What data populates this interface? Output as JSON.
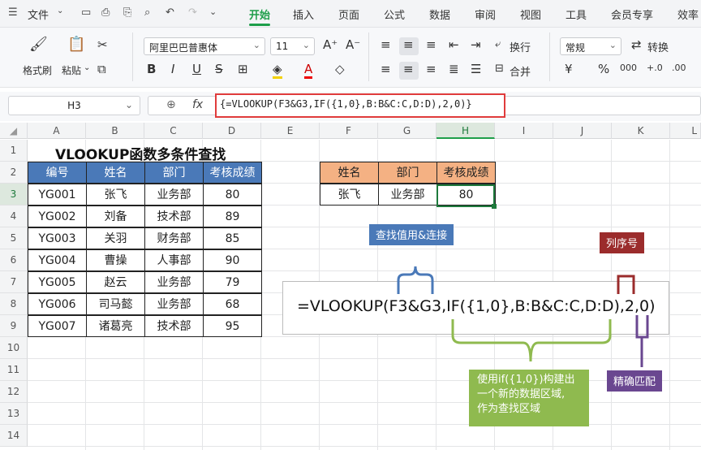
{
  "menubar": {
    "file": "文件",
    "tabs": [
      "开始",
      "插入",
      "页面",
      "公式",
      "数据",
      "审阅",
      "视图",
      "工具",
      "会员专享",
      "效率"
    ],
    "active_tab": "开始"
  },
  "ribbon": {
    "format_painter": "格式刷",
    "paste": "粘贴",
    "font_name": "阿里巴巴普惠体",
    "font_size": "11",
    "wrap": "换行",
    "merge": "合并",
    "number_format": "常规",
    "convert": "转换",
    "bold": "B",
    "italic": "I",
    "underline": "U",
    "strike": "S",
    "grow_font": "A⁺",
    "shrink_font": "A⁻",
    "currency": "¥",
    "percent": "%",
    "thousand": "000",
    "dec_inc": "+.0",
    "dec_dec": ".00"
  },
  "formula_bar": {
    "name_box": "H3",
    "fx": "fx",
    "formula": "{=VLOOKUP(F3&G3,IF({1,0},B:B&C:C,D:D),2,0)}"
  },
  "columns": [
    "A",
    "B",
    "C",
    "D",
    "E",
    "F",
    "G",
    "H",
    "I",
    "J",
    "K",
    "L"
  ],
  "rows": [
    "1",
    "2",
    "3",
    "4",
    "5",
    "6",
    "7",
    "8",
    "9",
    "10",
    "11",
    "12",
    "13",
    "14"
  ],
  "sheet": {
    "title": "VLOOKUP函数多条件查找",
    "table1": {
      "headers": [
        "编号",
        "姓名",
        "部门",
        "考核成绩"
      ],
      "rows": [
        [
          "YG001",
          "张飞",
          "业务部",
          "80"
        ],
        [
          "YG002",
          "刘备",
          "技术部",
          "89"
        ],
        [
          "YG003",
          "关羽",
          "财务部",
          "85"
        ],
        [
          "YG004",
          "曹操",
          "人事部",
          "90"
        ],
        [
          "YG005",
          "赵云",
          "业务部",
          "79"
        ],
        [
          "YG006",
          "司马懿",
          "业务部",
          "68"
        ],
        [
          "YG007",
          "诸葛亮",
          "技术部",
          "95"
        ]
      ]
    },
    "table2": {
      "headers": [
        "姓名",
        "部门",
        "考核成绩"
      ],
      "row": [
        "张飞",
        "业务部",
        "80"
      ]
    }
  },
  "annotations": {
    "formula": "=VLOOKUP(F3&G3,IF({1,0},B:B&C:C,D:D),2,0)",
    "lookup_value": "查找值用&连接",
    "col_index": "列序号",
    "if_note": [
      "使用if({1,0})构建出",
      "一个新的数据区域,",
      "作为查找区域"
    ],
    "exact_match": "精确匹配",
    "colors": {
      "lookup_value": "#4a79b8",
      "col_index": "#9b2c2c",
      "if_note": "#8fba4f",
      "exact_match": "#6a4790"
    }
  }
}
